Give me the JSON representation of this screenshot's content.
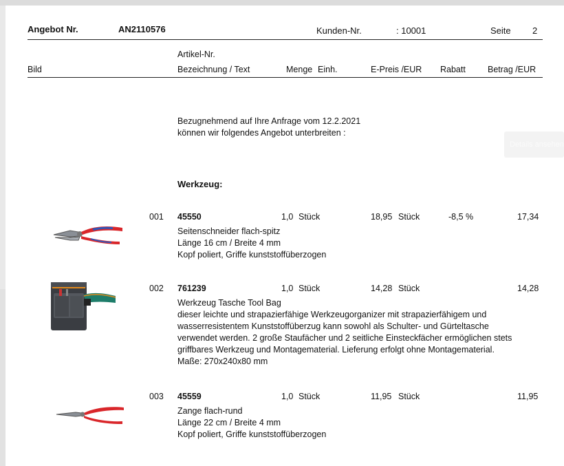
{
  "header": {
    "angebot_label": "Angebot Nr.",
    "angebot_number": "AN2110576",
    "kunden_label": "Kunden-Nr.",
    "kunden_value": ": 10001",
    "seite_label": "Seite",
    "seite_value": "2"
  },
  "columns": {
    "artikel_nr": "Artikel-Nr.",
    "bild": "Bild",
    "bezeichnung": "Bezeichnung / Text",
    "menge": "Menge",
    "einh": "Einh.",
    "epreis": "E-Preis /EUR",
    "rabatt": "Rabatt",
    "betrag": "Betrag /EUR"
  },
  "intro": {
    "line1": "Bezugnehmend auf Ihre Anfrage vom 12.2.2021",
    "line2": "können wir folgendes Angebot unterbreiten :"
  },
  "section_title": "Werkzeug:",
  "side_button": "Details ansehen",
  "items": [
    {
      "pos": "001",
      "artikel": "45550",
      "menge": "1,0",
      "einh": "Stück",
      "epreis": "18,95",
      "preis_einh": "Stück",
      "rabatt": "-8,5 %",
      "betrag": "17,34",
      "lines": [
        "Seitenschneider flach-spitz",
        "Länge 16 cm / Breite 4 mm",
        "Kopf poliert, Griffe kunststoffüberzogen"
      ],
      "image": "side-cutter-pliers"
    },
    {
      "pos": "002",
      "artikel": "761239",
      "menge": "1,0",
      "einh": "Stück",
      "epreis": "14,28",
      "preis_einh": "Stück",
      "rabatt": "",
      "betrag": "14,28",
      "lines": [
        "Werkzeug Tasche Tool Bag",
        "dieser leichte und strapazierfähige Werkzeugorganizer mit strapazierfähigem und",
        "wasserresistentem Kunststoffüberzug kann sowohl als Schulter- und Gürteltasche",
        "verwendet werden. 2 große Staufächer und 2 seitliche Einsteckfächer ermöglichen stets",
        "griffbares Werkzeug und Montagematerial. Lieferung erfolgt ohne Montagematerial.",
        "Maße: 270x240x80 mm"
      ],
      "image": "tool-bag"
    },
    {
      "pos": "003",
      "artikel": "45559",
      "menge": "1,0",
      "einh": "Stück",
      "epreis": "11,95",
      "preis_einh": "Stück",
      "rabatt": "",
      "betrag": "11,95",
      "lines": [
        "Zange flach-rund",
        "Länge 22 cm / Breite 4 mm",
        "Kopf poliert, Griffe kunststoffüberzogen"
      ],
      "image": "round-nose-pliers"
    }
  ]
}
